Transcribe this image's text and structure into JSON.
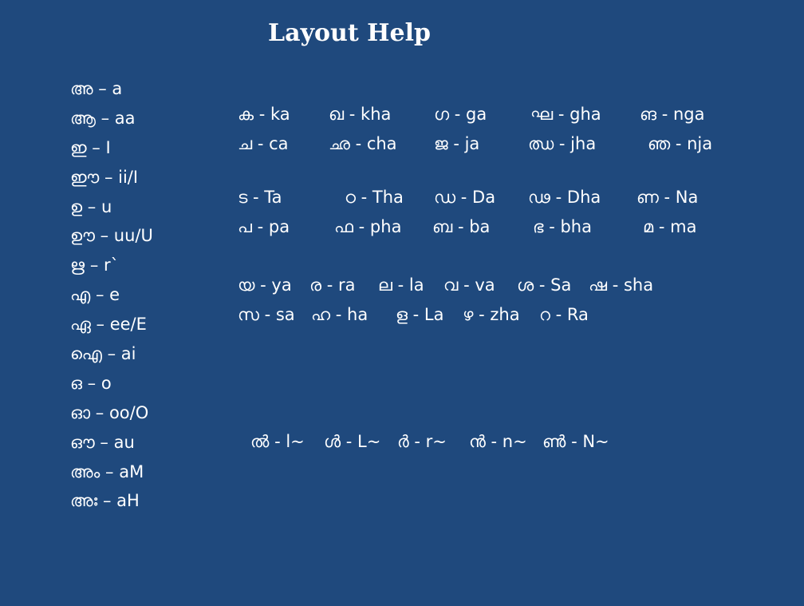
{
  "title": "Layout Help",
  "vowels": [
    "അ – a",
    "ആ – aa",
    "ഇ – I",
    "ഈ – ii/I",
    "ഉ – u",
    "ഊ – uu/U",
    "ഋ – r`",
    "എ – e",
    "ഏ – ee/E",
    "ഐ – ai",
    "ഒ – o",
    "ഓ – oo/O",
    "ഔ – au",
    "അം – aM",
    "അഃ – aH"
  ],
  "consonant_rows": [
    [
      "ക - ka",
      "ഖ - kha",
      "ഗ - ga",
      "ഘ - gha",
      "ങ - nga"
    ],
    [
      "ച - ca",
      "ഛ - cha",
      "ജ - ja",
      "ഝ - jha",
      "ഞ - nja"
    ],
    [
      "ട - Ta",
      "ഠ - Tha",
      "ഡ - Da",
      "ഢ - Dha",
      "ണ - Na"
    ],
    [
      "പ - pa",
      "ഫ - pha",
      "ബ - ba",
      "ഭ - bha",
      "മ - ma"
    ],
    [
      "യ - ya",
      "ര - ra",
      "ല - la",
      "വ - va",
      "ശ - Sa",
      "ഷ - sha"
    ],
    [
      "സ - sa",
      "ഹ - ha",
      "ള - La",
      "ഴ - zha",
      "റ - Ra"
    ],
    [
      "ൽ - l~",
      "ൾ - L~",
      "ർ - r~",
      "ൻ - n~",
      "ൺ - N~"
    ]
  ]
}
